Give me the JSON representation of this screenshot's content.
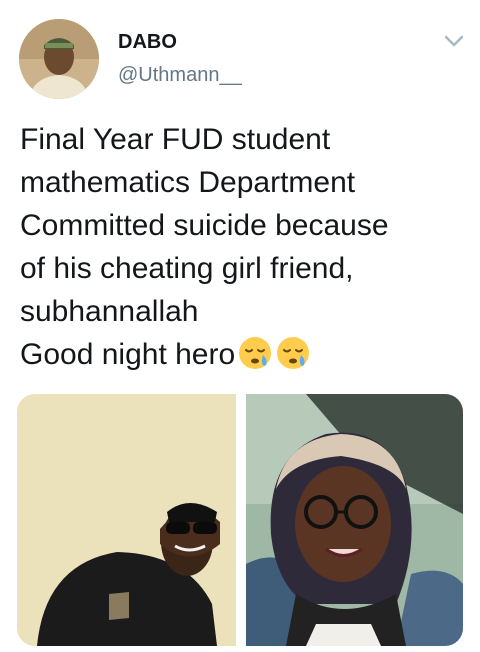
{
  "user": {
    "display_name": "DABO",
    "handle": "@Uthmann__",
    "avatar_icon": "profile-photo"
  },
  "menu_icon": "chevron-down-icon",
  "tweet": {
    "lines": [
      "Final Year FUD student",
      "mathematics Department",
      "Committed suicide because",
      "of his cheating girl friend,",
      "subhannallah",
      "Good night hero"
    ],
    "emojis": [
      "sleepy-face-icon",
      "sleepy-face-icon"
    ]
  },
  "media": [
    {
      "name": "photo-young-man-sunglasses",
      "background": "#efe7c5"
    },
    {
      "name": "photo-young-woman-glasses",
      "background": "#9fb8a6"
    }
  ],
  "colors": {
    "text": "#14171a",
    "secondary": "#657786",
    "emoji": "#ffcc4d"
  }
}
